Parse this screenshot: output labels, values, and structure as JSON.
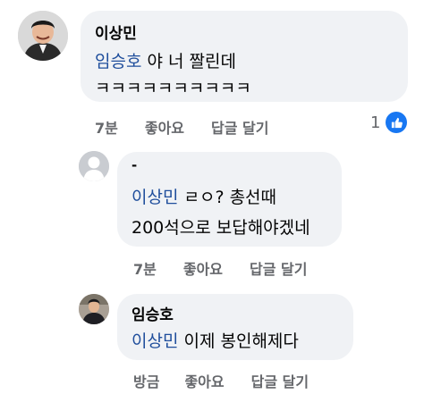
{
  "comment1": {
    "author": "이상민",
    "mention": "임승호",
    "text_line1": " 야 너 짤린데",
    "text_line2": "ㅋㅋㅋㅋㅋㅋㅋㅋㅋㅋ",
    "time": "7분",
    "like_label": "좋아요",
    "reply_label": "답글 달기",
    "reaction_count": "1"
  },
  "reply1": {
    "author": "-",
    "mention": "이상민",
    "text_line1": " ㄹㅇ? 총선때",
    "text_line2": "200석으로 보답해야겠네",
    "time": "7분",
    "like_label": "좋아요",
    "reply_label": "답글 달기"
  },
  "reply2": {
    "author": "임승호",
    "mention": "이상민",
    "text_line1": " 이제 봉인해제다",
    "time": "방금",
    "like_label": "좋아요",
    "reply_label": "답글 달기"
  },
  "colors": {
    "bubble": "#f0f2f5",
    "mention": "#1f4e9c",
    "meta": "#65676b",
    "like": "#1877f2"
  }
}
